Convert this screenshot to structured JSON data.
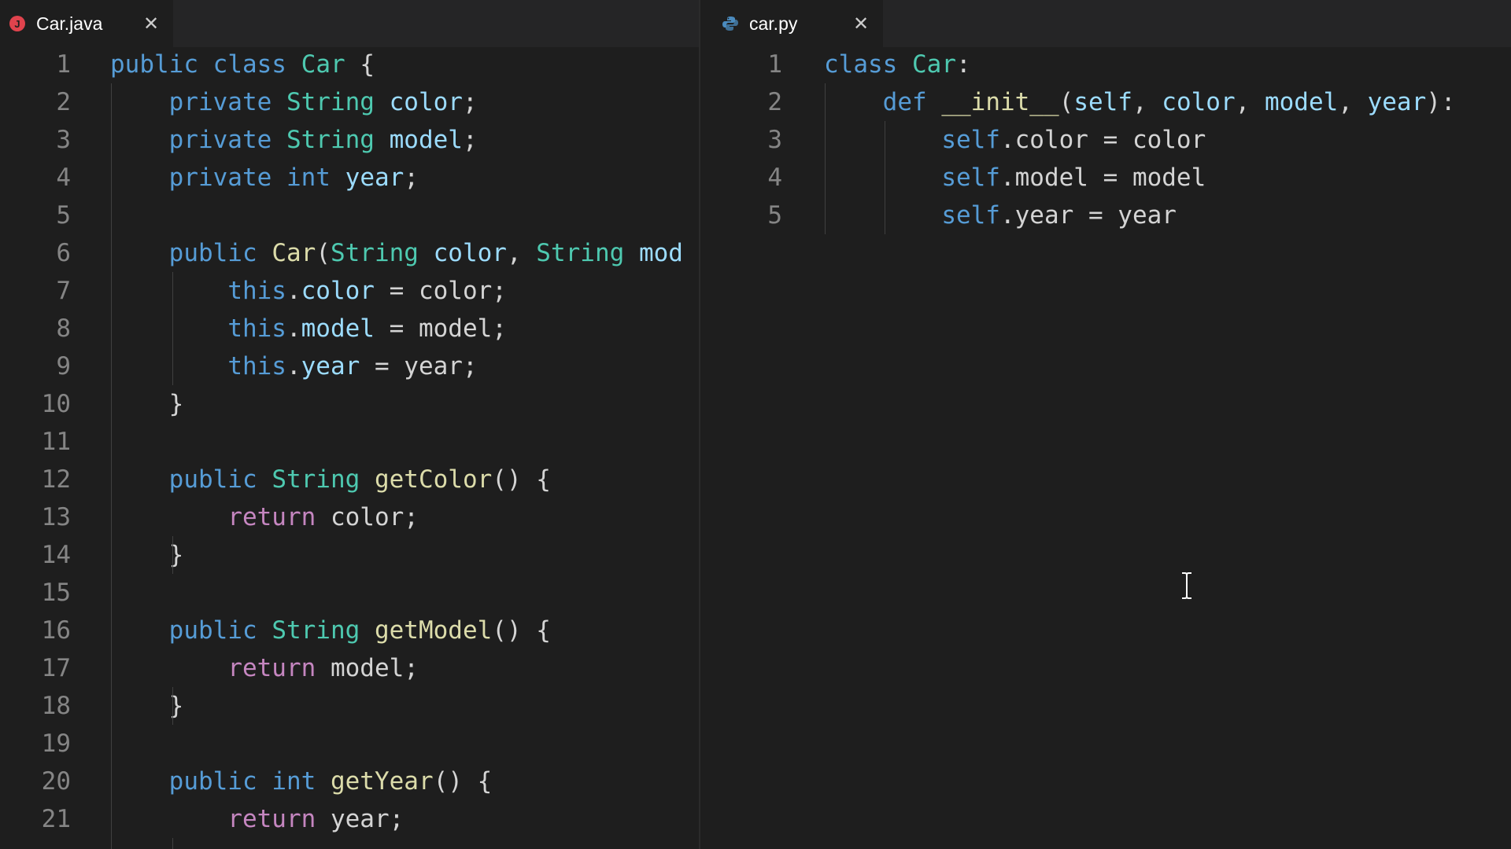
{
  "left_tab": {
    "label": "Car.java",
    "icon": "java-icon",
    "close": "✕"
  },
  "right_tab": {
    "label": "car.py",
    "icon": "python-icon",
    "close": "✕"
  },
  "java": {
    "line_numbers": [
      "1",
      "2",
      "3",
      "4",
      "5",
      "6",
      "7",
      "8",
      "9",
      "10",
      "11",
      "12",
      "13",
      "14",
      "15",
      "16",
      "17",
      "18",
      "19",
      "20",
      "21"
    ],
    "lines": [
      [
        [
          "kw",
          "public"
        ],
        [
          "pl",
          " "
        ],
        [
          "kw",
          "class"
        ],
        [
          "pl",
          " "
        ],
        [
          "ty",
          "Car"
        ],
        [
          "pl",
          " {"
        ]
      ],
      [
        [
          "pl",
          "    "
        ],
        [
          "kw",
          "private"
        ],
        [
          "pl",
          " "
        ],
        [
          "ty",
          "String"
        ],
        [
          "pl",
          " "
        ],
        [
          "vr",
          "color"
        ],
        [
          "pl",
          ";"
        ]
      ],
      [
        [
          "pl",
          "    "
        ],
        [
          "kw",
          "private"
        ],
        [
          "pl",
          " "
        ],
        [
          "ty",
          "String"
        ],
        [
          "pl",
          " "
        ],
        [
          "vr",
          "model"
        ],
        [
          "pl",
          ";"
        ]
      ],
      [
        [
          "pl",
          "    "
        ],
        [
          "kw",
          "private"
        ],
        [
          "pl",
          " "
        ],
        [
          "kw",
          "int"
        ],
        [
          "pl",
          " "
        ],
        [
          "vr",
          "year"
        ],
        [
          "pl",
          ";"
        ]
      ],
      [],
      [
        [
          "pl",
          "    "
        ],
        [
          "kw",
          "public"
        ],
        [
          "pl",
          " "
        ],
        [
          "fn",
          "Car"
        ],
        [
          "pl",
          "("
        ],
        [
          "ty",
          "String"
        ],
        [
          "pl",
          " "
        ],
        [
          "vr",
          "color"
        ],
        [
          "pl",
          ", "
        ],
        [
          "ty",
          "String"
        ],
        [
          "pl",
          " "
        ],
        [
          "vr",
          "mod"
        ]
      ],
      [
        [
          "pl",
          "        "
        ],
        [
          "kw",
          "this"
        ],
        [
          "pl",
          "."
        ],
        [
          "vr",
          "color"
        ],
        [
          "pl",
          " = color;"
        ]
      ],
      [
        [
          "pl",
          "        "
        ],
        [
          "kw",
          "this"
        ],
        [
          "pl",
          "."
        ],
        [
          "vr",
          "model"
        ],
        [
          "pl",
          " = model;"
        ]
      ],
      [
        [
          "pl",
          "        "
        ],
        [
          "kw",
          "this"
        ],
        [
          "pl",
          "."
        ],
        [
          "vr",
          "year"
        ],
        [
          "pl",
          " = year;"
        ]
      ],
      [
        [
          "pl",
          "    }"
        ]
      ],
      [],
      [
        [
          "pl",
          "    "
        ],
        [
          "kw",
          "public"
        ],
        [
          "pl",
          " "
        ],
        [
          "ty",
          "String"
        ],
        [
          "pl",
          " "
        ],
        [
          "fn",
          "getColor"
        ],
        [
          "pl",
          "() {"
        ]
      ],
      [
        [
          "pl",
          "        "
        ],
        [
          "ctl",
          "return"
        ],
        [
          "pl",
          " color;"
        ]
      ],
      [
        [
          "pl",
          "    }"
        ]
      ],
      [],
      [
        [
          "pl",
          "    "
        ],
        [
          "kw",
          "public"
        ],
        [
          "pl",
          " "
        ],
        [
          "ty",
          "String"
        ],
        [
          "pl",
          " "
        ],
        [
          "fn",
          "getModel"
        ],
        [
          "pl",
          "() {"
        ]
      ],
      [
        [
          "pl",
          "        "
        ],
        [
          "ctl",
          "return"
        ],
        [
          "pl",
          " model;"
        ]
      ],
      [
        [
          "pl",
          "    }"
        ]
      ],
      [],
      [
        [
          "pl",
          "    "
        ],
        [
          "kw",
          "public"
        ],
        [
          "pl",
          " "
        ],
        [
          "kw",
          "int"
        ],
        [
          "pl",
          " "
        ],
        [
          "fn",
          "getYear"
        ],
        [
          "pl",
          "() {"
        ]
      ],
      [
        [
          "pl",
          "        "
        ],
        [
          "ctl",
          "return"
        ],
        [
          "pl",
          " year;"
        ]
      ]
    ]
  },
  "python": {
    "line_numbers": [
      "1",
      "2",
      "3",
      "4",
      "5"
    ],
    "lines": [
      [
        [
          "kw",
          "class"
        ],
        [
          "pl",
          " "
        ],
        [
          "ty",
          "Car"
        ],
        [
          "pl",
          ":"
        ]
      ],
      [
        [
          "pl",
          "    "
        ],
        [
          "kw",
          "def"
        ],
        [
          "pl",
          " "
        ],
        [
          "fn",
          "__init__"
        ],
        [
          "pl",
          "("
        ],
        [
          "vr",
          "self"
        ],
        [
          "pl",
          ", "
        ],
        [
          "vr",
          "color"
        ],
        [
          "pl",
          ", "
        ],
        [
          "vr",
          "model"
        ],
        [
          "pl",
          ", "
        ],
        [
          "vr",
          "year"
        ],
        [
          "pl",
          "):"
        ]
      ],
      [
        [
          "pl",
          "        "
        ],
        [
          "kw",
          "self"
        ],
        [
          "pl",
          ".color = color"
        ]
      ],
      [
        [
          "pl",
          "        "
        ],
        [
          "kw",
          "self"
        ],
        [
          "pl",
          ".model = model"
        ]
      ],
      [
        [
          "pl",
          "        "
        ],
        [
          "kw",
          "self"
        ],
        [
          "pl",
          ".year = year"
        ]
      ]
    ]
  },
  "colors": {
    "background": "#1e1e1e",
    "keyword": "#569cd6",
    "type": "#4ec9b0",
    "function": "#dcdcaa",
    "variable": "#9cdcfe",
    "control": "#c586c0",
    "plain": "#d4d4d4",
    "line_number": "#858585"
  },
  "cursor": {
    "type": "text-cursor-ibeam"
  }
}
